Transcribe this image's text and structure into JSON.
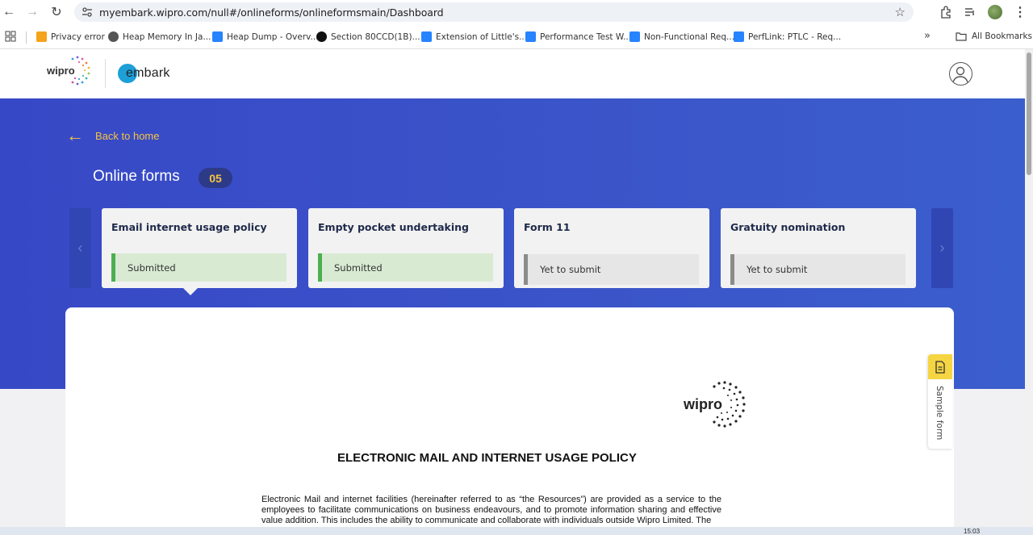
{
  "browser": {
    "url": "myembark.wipro.com/null#/onlineforms/onlineformsmain/Dashboard",
    "bookmarks": [
      {
        "label": "Privacy error",
        "icon": "warning-page-icon",
        "color": "#f4a31d"
      },
      {
        "label": "Heap Memory In Ja...",
        "icon": "globe-icon",
        "color": "#555555"
      },
      {
        "label": "Heap Dump - Overv...",
        "icon": "confluence-icon",
        "color": "#2684ff"
      },
      {
        "label": "Section 80CCD(1B)...",
        "icon": "site-icon",
        "color": "#111111"
      },
      {
        "label": "Extension of Little's...",
        "icon": "confluence-icon",
        "color": "#2684ff"
      },
      {
        "label": "Performance Test W...",
        "icon": "confluence-icon",
        "color": "#2684ff"
      },
      {
        "label": "Non-Functional Req...",
        "icon": "confluence-icon",
        "color": "#2684ff"
      },
      {
        "label": "PerfLink: PTLC - Req...",
        "icon": "confluence-icon",
        "color": "#2684ff"
      }
    ],
    "all_bookmarks": "All Bookmarks"
  },
  "header": {
    "brand": "wipro",
    "product": "embark"
  },
  "banner": {
    "back_label": "Back to home",
    "title": "Online forms",
    "count": "05",
    "accent_color": "#f5c542",
    "background_color": "#3a51c8"
  },
  "forms": [
    {
      "title": "Email internet usage policy",
      "status": "Submitted",
      "state": "done"
    },
    {
      "title": "Empty pocket undertaking",
      "status": "Submitted",
      "state": "done"
    },
    {
      "title": "Form 11",
      "status": "Yet to submit",
      "state": "pending"
    },
    {
      "title": "Gratuity nomination",
      "status": "Yet to submit",
      "state": "pending"
    }
  ],
  "document": {
    "logo_text": "wipro",
    "heading": "ELECTRONIC MAIL AND INTERNET USAGE POLICY",
    "body": "Electronic Mail and internet facilities (hereinafter referred to as “the Resources”) are provided as a service to the employees to facilitate communications on business endeavours, and to promote information sharing and effective value addition. This includes the ability to communicate and collaborate with individuals outside Wipro Limited. The"
  },
  "sample_tab": {
    "label": "Sample form"
  },
  "taskbar": {
    "time": "15:03"
  }
}
